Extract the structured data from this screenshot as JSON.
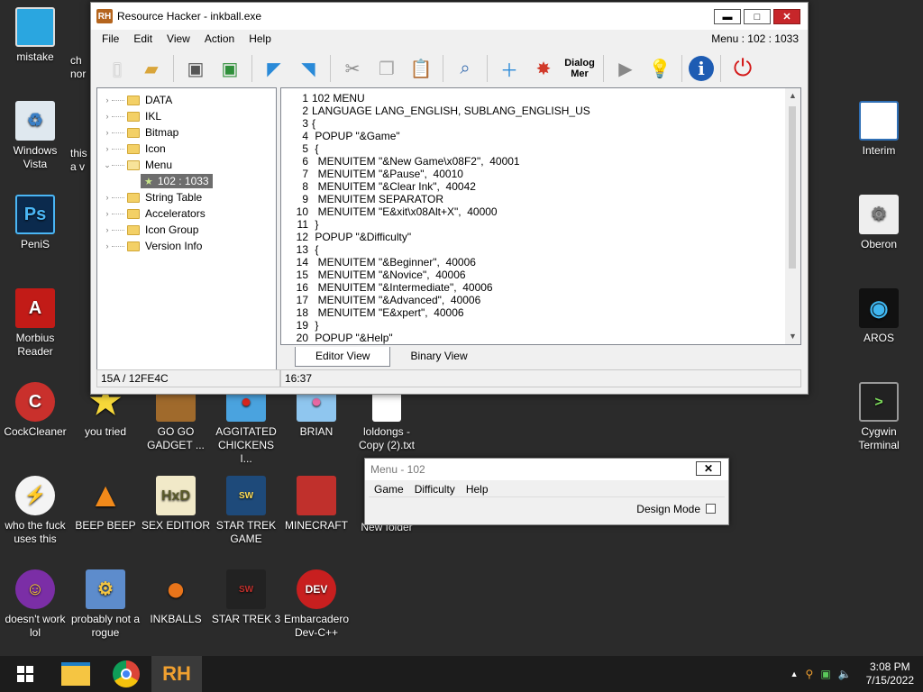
{
  "desktop": {
    "left_column": [
      {
        "label": "mistake"
      },
      {
        "label": "Windows Vista"
      },
      {
        "label": "PeniS"
      },
      {
        "label": "Morbius Reader"
      },
      {
        "label": "CockCleaner"
      },
      {
        "label": "who the fuck uses this"
      },
      {
        "label": "doesn't work lol"
      }
    ],
    "left_partial": [
      {
        "label": "ch nor"
      },
      {
        "label": "this a v"
      }
    ],
    "row_5": [
      {
        "label": "you tried"
      },
      {
        "label": "GO GO GADGET ..."
      },
      {
        "label": "AGGITATED CHICKENS I..."
      },
      {
        "label": "BRIAN"
      },
      {
        "label": "loldongs - Copy (2).txt"
      }
    ],
    "row_6": [
      {
        "label": "BEEP BEEP"
      },
      {
        "label": "SEX EDITIOR"
      },
      {
        "label": "STAR TREK GAME"
      },
      {
        "label": "MINECRAFT"
      },
      {
        "label": "New folder"
      }
    ],
    "row_7": [
      {
        "label": "probably not a rogue"
      },
      {
        "label": "INKBALLS"
      },
      {
        "label": "STAR TREK 3"
      },
      {
        "label": "Embarcadero Dev-C++"
      }
    ],
    "right_column": [
      {
        "label": "Interim"
      },
      {
        "label": "Oberon"
      },
      {
        "label": "AROS"
      },
      {
        "label": "Cygwin Terminal"
      }
    ]
  },
  "rh_window": {
    "logo": "RH",
    "title": "Resource Hacker - inkball.exe",
    "menu": [
      "File",
      "Edit",
      "View",
      "Action",
      "Help"
    ],
    "resource_ref": "Menu : 102 : 1033",
    "toolbar_dialog_label": "Dialog Mer",
    "tree": [
      {
        "label": "DATA",
        "expander": "›"
      },
      {
        "label": "IKL",
        "expander": "›"
      },
      {
        "label": "Bitmap",
        "expander": "›"
      },
      {
        "label": "Icon",
        "expander": "›"
      },
      {
        "label": "Menu",
        "expander": "⌄"
      },
      {
        "label": "String Table",
        "expander": "›"
      },
      {
        "label": "Accelerators",
        "expander": "›"
      },
      {
        "label": "Icon Group",
        "expander": "›"
      },
      {
        "label": "Version Info",
        "expander": "›"
      }
    ],
    "tree_selected_child": "102 : 1033",
    "line_numbers": [
      "1",
      "2",
      "3",
      "4",
      "5",
      "6",
      "7",
      "8",
      "9",
      "10",
      "11",
      "12",
      "13",
      "14",
      "15",
      "16",
      "17",
      "18",
      "19",
      "20"
    ],
    "code_lines": [
      "102 MENU",
      "LANGUAGE LANG_ENGLISH, SUBLANG_ENGLISH_US",
      "{",
      " POPUP \"&Game\"",
      " {",
      "  MENUITEM \"&New Game\\x08F2\",  40001",
      "  MENUITEM \"&Pause\",  40010",
      "  MENUITEM \"&Clear Ink\",  40042",
      "  MENUITEM SEPARATOR",
      "  MENUITEM \"E&xit\\x08Alt+X\",  40000",
      " }",
      " POPUP \"&Difficulty\"",
      " {",
      "  MENUITEM \"&Beginner\",  40006",
      "  MENUITEM \"&Novice\",  40006",
      "  MENUITEM \"&Intermediate\",  40006",
      "  MENUITEM \"&Advanced\",  40006",
      "  MENUITEM \"E&xpert\",  40006",
      " }",
      " POPUP \"&Help\""
    ],
    "tabs": [
      "Editor View",
      "Binary View"
    ],
    "status_left": "15A / 12FE4C",
    "status_right": "16:37"
  },
  "menu_preview": {
    "title": "Menu -  102",
    "menu": [
      "Game",
      "Difficulty",
      "Help"
    ],
    "design_mode_label": "Design Mode"
  },
  "taskbar": {
    "time": "3:08 PM",
    "date": "7/15/2022",
    "rh_label": "RH"
  }
}
